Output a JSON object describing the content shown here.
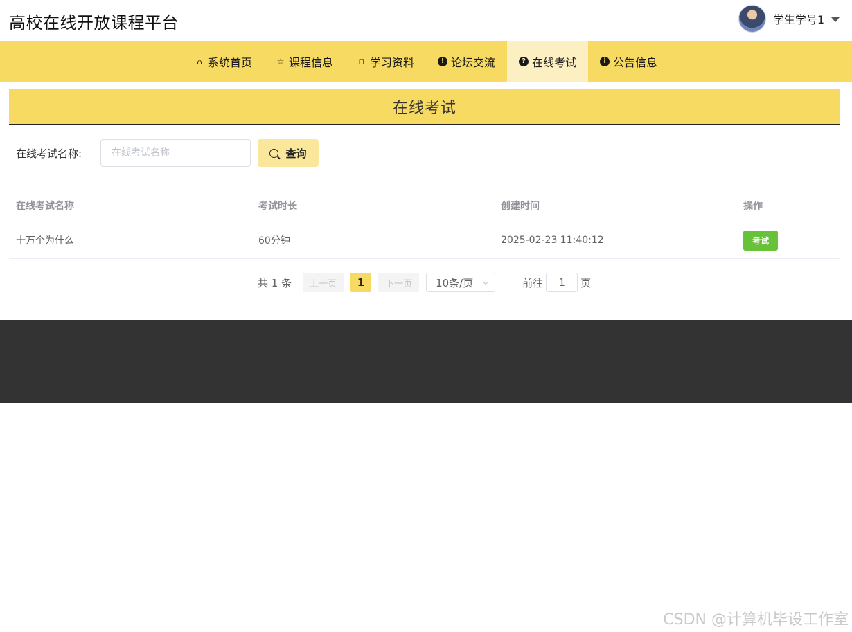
{
  "header": {
    "site_title": "高校在线开放课程平台",
    "user_name": "学生学号1",
    "avatar_icon": "user-avatar",
    "dropdown_icon": "caret-down-icon"
  },
  "nav": {
    "items": [
      {
        "label": "系统首页",
        "icon": "home-icon",
        "glyph": "⌂"
      },
      {
        "label": "课程信息",
        "icon": "star-icon",
        "glyph": "☆"
      },
      {
        "label": "学习资料",
        "icon": "bag-icon",
        "glyph": "⊓"
      },
      {
        "label": "论坛交流",
        "icon": "exclamation-circle-icon",
        "glyph": "!"
      },
      {
        "label": "在线考试",
        "icon": "question-circle-icon",
        "glyph": "?"
      },
      {
        "label": "公告信息",
        "icon": "info-circle-icon",
        "glyph": "i"
      }
    ],
    "active_index": 4,
    "bg_color": "#f6da62",
    "active_color": "#fcefc1"
  },
  "section": {
    "title": "在线考试"
  },
  "search": {
    "label": "在线考试名称:",
    "placeholder": "在线考试名称",
    "value": "",
    "button_label": "查询"
  },
  "table": {
    "columns": [
      "在线考试名称",
      "考试时长",
      "创建时间",
      "操作"
    ],
    "rows": [
      {
        "name": "十万个为什么",
        "duration": "60分钟",
        "created": "2025-02-23 11:40:12",
        "action": "考试"
      }
    ]
  },
  "pagination": {
    "total_text": "共 1 条",
    "prev_label": "上一页",
    "current_page": "1",
    "next_label": "下一页",
    "page_size": "10条/页",
    "goto_prefix": "前往",
    "goto_value": "1",
    "goto_suffix": "页"
  },
  "watermark": "CSDN @计算机毕设工作室",
  "colors": {
    "accent": "#f6da62",
    "exam_button": "#67c23a",
    "footer": "#333333"
  }
}
